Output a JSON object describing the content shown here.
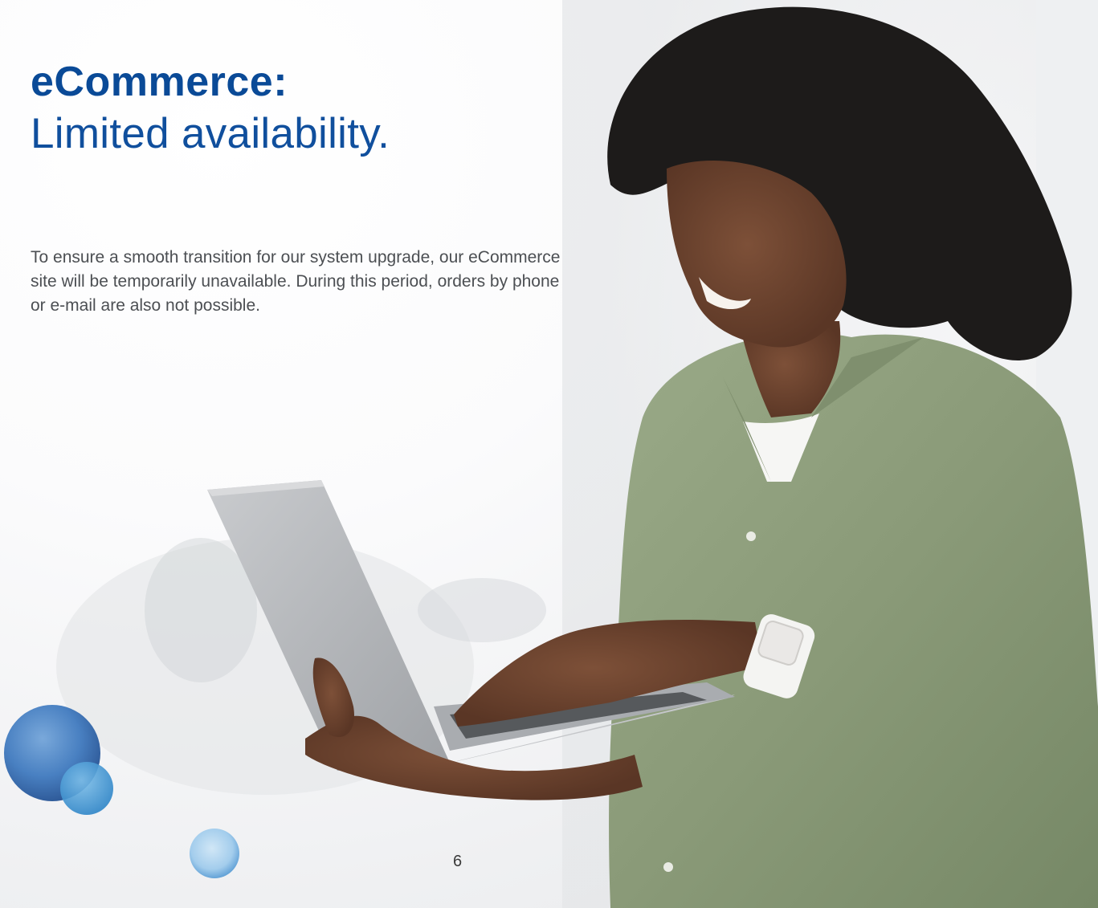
{
  "heading": {
    "bold": "eCommerce:",
    "light": "Limited availability."
  },
  "body_text": "To ensure a smooth transition for our system upgrade, our eCommerce site will be temporarily unavailable. During this period, orders by phone or e-mail are also not possible.",
  "page_number": "6",
  "colors": {
    "brand_blue": "#0a4a97",
    "body_gray": "#4c4f53",
    "shirt_green": "#8a9a78",
    "hair": "#1d1b1a",
    "skin": "#6e4632",
    "laptop": "#b3b5b8",
    "watercolor_blue": "#2e6db5"
  },
  "images": {
    "photo": "woman-with-laptop-photo",
    "decoration": "watercolor-dots"
  }
}
